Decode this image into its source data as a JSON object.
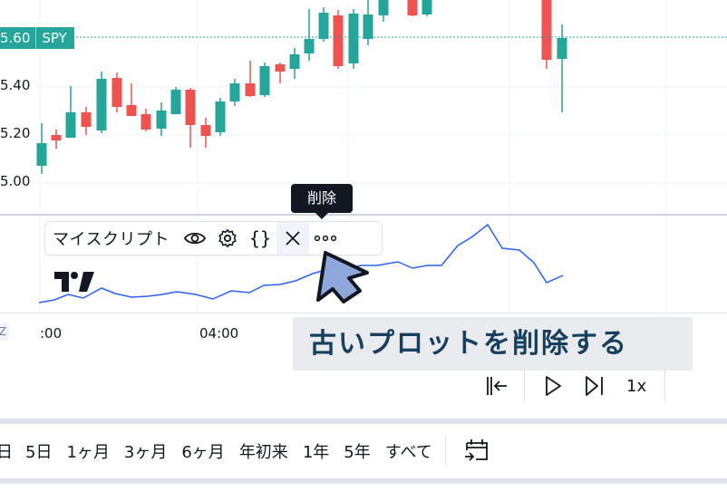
{
  "price_axis": {
    "last_price": "5.60",
    "symbol": "SPY",
    "labels": [
      "5.40",
      "5.20",
      "5.00"
    ]
  },
  "tooltip": {
    "text": "削除"
  },
  "indicator_legend": {
    "name": "マイスクリプト",
    "icons": [
      "eye-icon",
      "gear-icon",
      "braces-icon",
      "close-icon",
      "more-icon"
    ],
    "braces": "{}"
  },
  "time_axis": {
    "timezone_badge": "Z",
    "labels": [
      ":00",
      "04:00"
    ]
  },
  "caption": {
    "text": "古いプロットを削除する"
  },
  "replay_controls": {
    "speed": "1x",
    "icons": [
      "jump-to-start-icon",
      "play-icon",
      "step-forward-icon"
    ]
  },
  "range_bar": {
    "items": [
      "日",
      "5日",
      "1ヶ月",
      "3ヶ月",
      "6ヶ月",
      "年初来",
      "1年",
      "5年",
      "すべて"
    ]
  },
  "colors": {
    "up": "#26a69a",
    "down": "#ef5350",
    "line": "#2962ff",
    "price_line": "#26a69a",
    "caption_text": "#17405f",
    "arrow_fill": "#8ea8dc"
  }
}
